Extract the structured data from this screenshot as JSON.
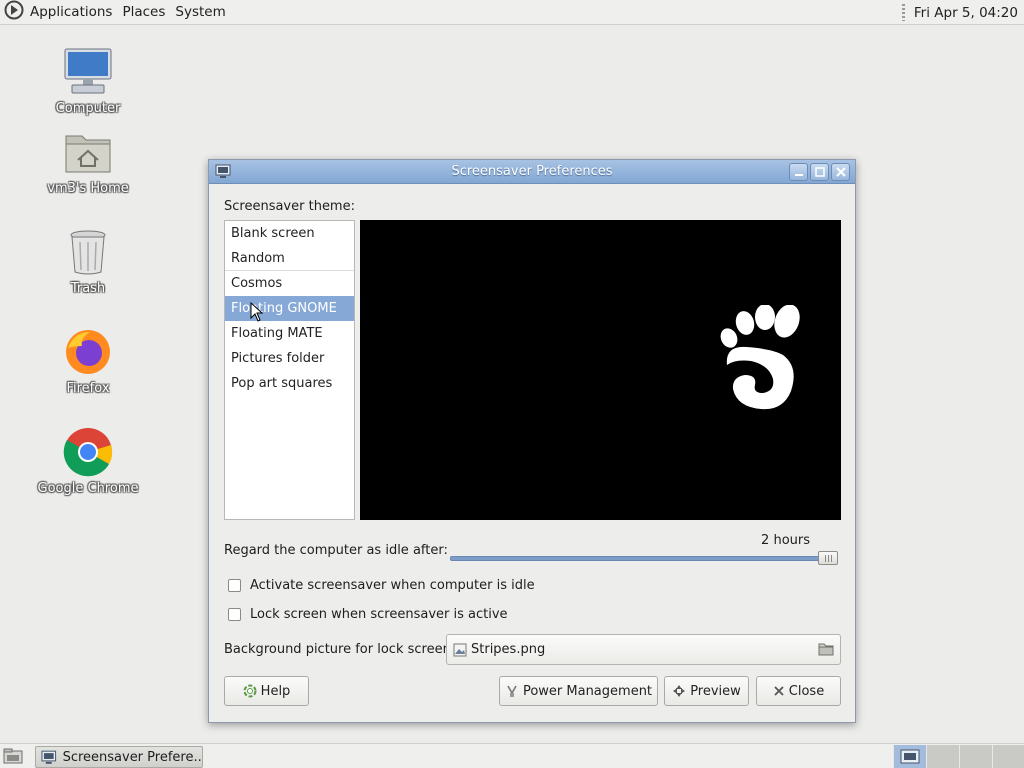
{
  "top_panel": {
    "menus": [
      "Applications",
      "Places",
      "System"
    ],
    "clock": "Fri Apr  5, 04:20"
  },
  "desktop": {
    "icons": [
      {
        "label": "Computer",
        "icon": "computer-icon"
      },
      {
        "label": "vm3's Home",
        "icon": "home-folder-icon"
      },
      {
        "label": "Trash",
        "icon": "trash-icon"
      },
      {
        "label": "Firefox",
        "icon": "firefox-icon"
      },
      {
        "label": "Google Chrome",
        "icon": "chrome-icon"
      }
    ]
  },
  "window": {
    "title": "Screensaver Preferences",
    "theme_label": "Screensaver theme:",
    "themes": [
      "Blank screen",
      "Random",
      "Cosmos",
      "Floating GNOME",
      "Floating MATE",
      "Pictures folder",
      "Pop art squares"
    ],
    "selected_theme": "Floating GNOME",
    "idle_label": "Regard the computer as idle after:",
    "idle_value": "2 hours",
    "idle_fraction": 1.0,
    "activate_label": "Activate screensaver when computer is idle",
    "activate_checked": false,
    "lock_label": "Lock screen when screensaver is active",
    "lock_checked": false,
    "bg_label": "Background picture for lock screen:",
    "bg_file": "Stripes.png",
    "buttons": {
      "help": "Help",
      "power": "Power Management",
      "preview": "Preview",
      "close": "Close"
    }
  },
  "taskbar": {
    "task_label": "Screensaver Prefere..."
  },
  "colors": {
    "titlebar": "#82a7d4",
    "selection": "#86a8d6",
    "preview_bg": "#000000"
  }
}
